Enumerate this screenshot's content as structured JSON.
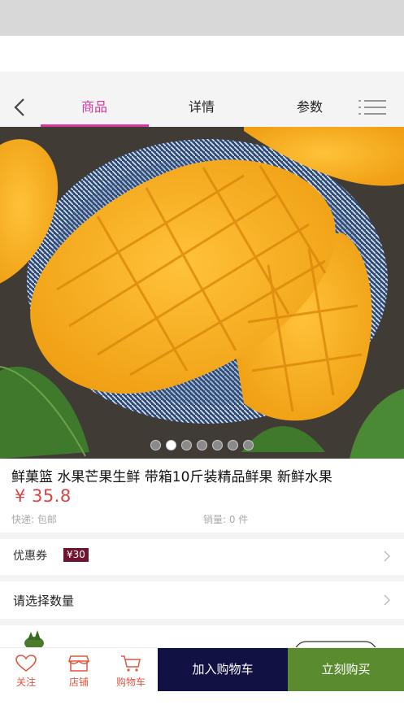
{
  "tabs": [
    {
      "label": "商品",
      "active": true
    },
    {
      "label": "详情",
      "active": false
    },
    {
      "label": "参数",
      "active": false
    }
  ],
  "icons": {
    "back": "chevron-left-icon",
    "menu": "list-menu-icon",
    "follow": "heart-icon",
    "store": "store-icon",
    "cart": "shopping-cart-icon"
  },
  "carousel": {
    "slide_count": 7,
    "active_index": 1
  },
  "product": {
    "title": "鲜菓篮 水果芒果生鲜 带箱10斤装精品鲜果 新鲜水果",
    "price": "¥ 35.8",
    "shipping": "快递: 包邮",
    "sales": "销量: 0 件"
  },
  "coupon": {
    "label": "优惠券",
    "badge": "¥30"
  },
  "quantity": {
    "label": "请选择数量"
  },
  "bottom_bar": {
    "follow_label": "关注",
    "store_label": "店铺",
    "cart_label": "购物车",
    "add_to_cart": "加入购物车",
    "buy_now": "立刻购买"
  },
  "colors": {
    "accent": "#d9359b",
    "price": "#d84545",
    "cart_button": "#111143",
    "buy_button": "#5b8b2f",
    "coupon_badge": "#6e1430",
    "icon_label": "#e2563f"
  }
}
